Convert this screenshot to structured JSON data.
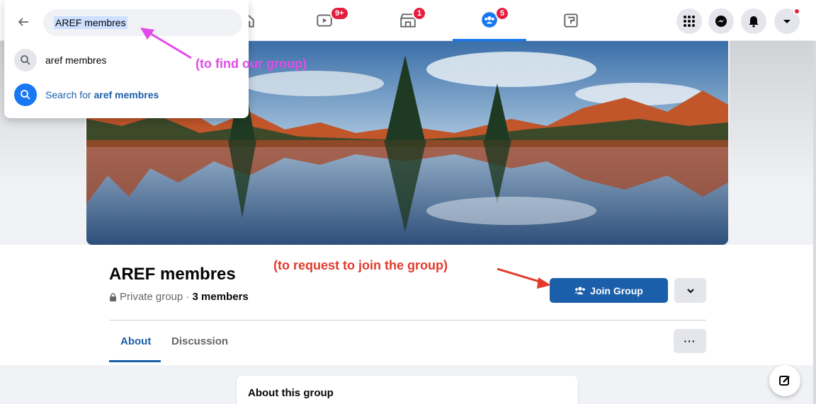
{
  "search": {
    "query": "AREF membres",
    "suggestions": [
      {
        "text": "aref membres",
        "icon": "search-icon"
      },
      {
        "prefix": "Search for ",
        "bold": "aref membres",
        "icon": "search-icon"
      }
    ]
  },
  "nav": {
    "tabs": [
      {
        "name": "home",
        "badge": ""
      },
      {
        "name": "watch",
        "badge": "9+"
      },
      {
        "name": "marketplace",
        "badge": "1"
      },
      {
        "name": "groups",
        "badge": "5",
        "active": true
      },
      {
        "name": "gaming",
        "badge": ""
      }
    ],
    "right_icons": [
      "menu-grid-icon",
      "messenger-icon",
      "notifications-icon",
      "account-caret-icon"
    ]
  },
  "group": {
    "title": "AREF membres",
    "privacy": "Private group · ",
    "members": "3 members",
    "join_label": "Join Group",
    "tabs": [
      "About",
      "Discussion"
    ],
    "more_label": "···",
    "about_heading": "About this group"
  },
  "annotations": {
    "find": "(to find our group)",
    "join": "(to request to join the group)"
  },
  "colors": {
    "accent": "#1b5faa",
    "badge": "#e41e3f",
    "annotation_find": "#e14be8",
    "annotation_join": "#e23a2c"
  }
}
